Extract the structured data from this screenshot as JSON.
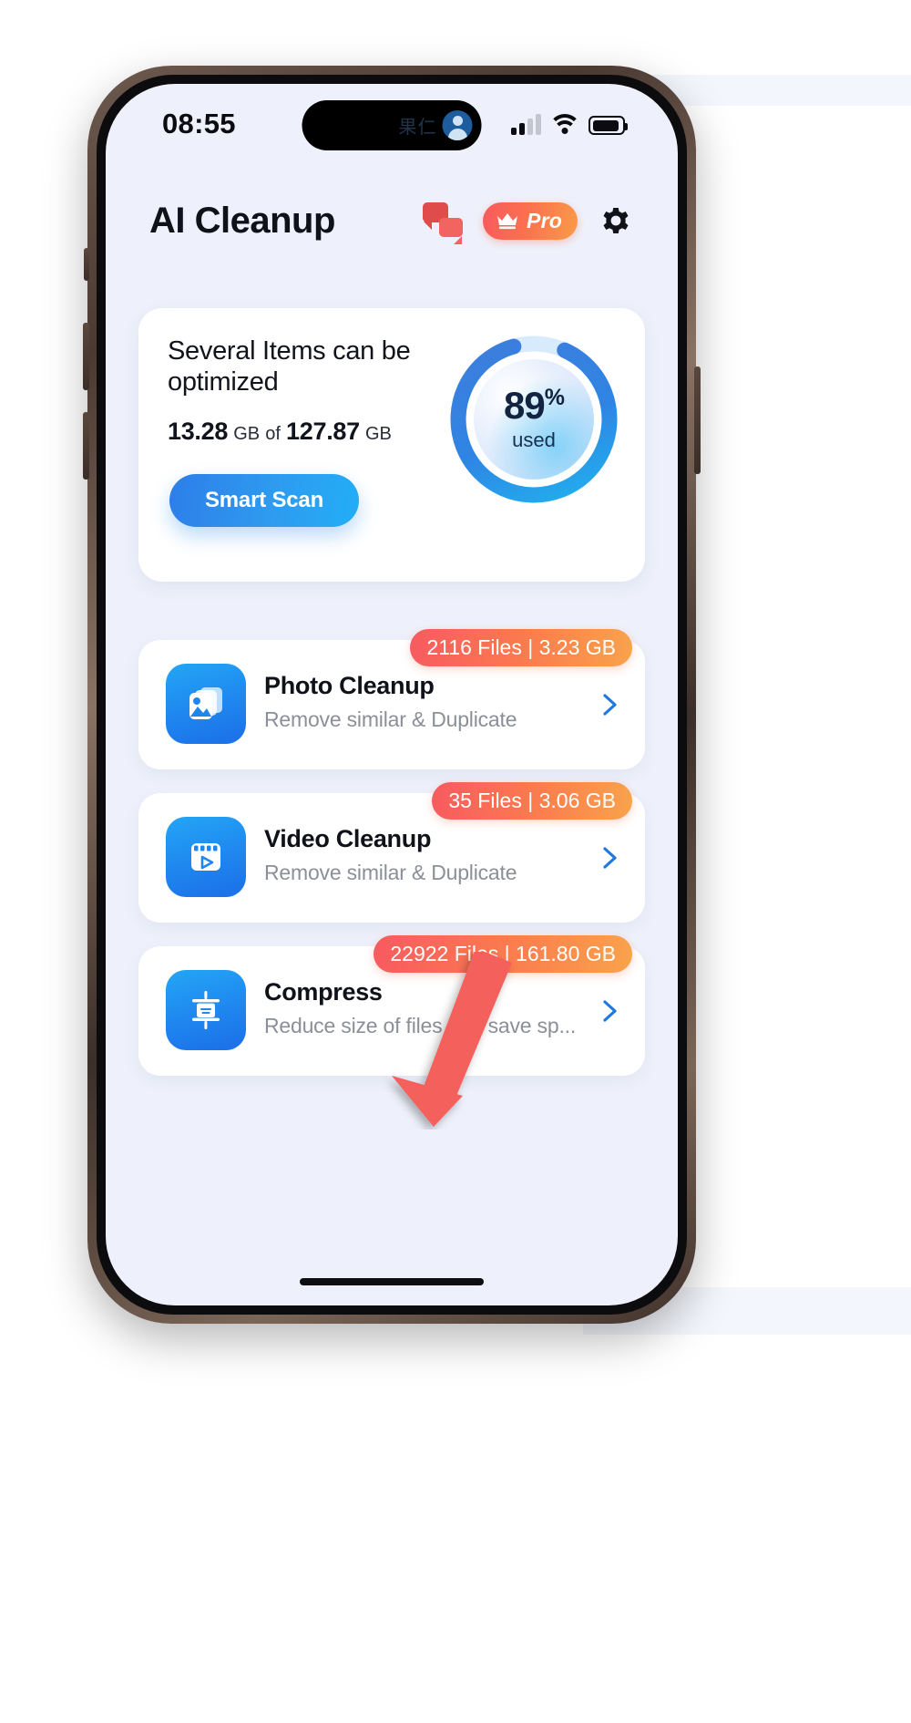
{
  "status_bar": {
    "time": "08:55",
    "island_label": "果仁",
    "signal_icon": "cellular-signal-icon",
    "wifi_icon": "wifi-icon",
    "battery_icon": "battery-icon"
  },
  "header": {
    "title": "AI Cleanup",
    "chat_icon": "chat-bubbles-icon",
    "pro_label": "Pro",
    "crown_icon": "crown-icon",
    "settings_icon": "gear-icon"
  },
  "summary": {
    "title": "Several Items can be optimized",
    "used_value": "13.28",
    "used_unit": "GB",
    "of_word": "of",
    "total_value": "127.87",
    "total_unit": "GB",
    "scan_button": "Smart Scan",
    "donut": {
      "percent": "89",
      "percent_symbol": "%",
      "caption": "used",
      "value": 89,
      "track_color": "#d6eafd",
      "progress_color": "#3d7fe0"
    }
  },
  "features": [
    {
      "name": "Photo Cleanup",
      "subtitle": "Remove similar & Duplicate",
      "badge": "2116 Files | 3.23 GB",
      "icon": "photo-stack-icon",
      "chevron": "chevron-right-icon"
    },
    {
      "name": "Video Cleanup",
      "subtitle": "Remove similar & Duplicate",
      "badge": "35 Files | 3.06 GB",
      "icon": "video-play-icon",
      "chevron": "chevron-right-icon"
    },
    {
      "name": "Compress",
      "subtitle": "Reduce size of files and save sp...",
      "badge": "22922 Files | 161.80 GB",
      "icon": "compress-icon",
      "chevron": "chevron-right-icon"
    }
  ],
  "annotation": {
    "arrow": "red-pointer-arrow",
    "color": "#f4605c"
  },
  "colors": {
    "screen_bg": "#eef1fb",
    "card_bg": "#ffffff",
    "accent_blue": "#2d8ceb",
    "badge_gradient_start": "#f85a60",
    "badge_gradient_end": "#f9a34b"
  }
}
